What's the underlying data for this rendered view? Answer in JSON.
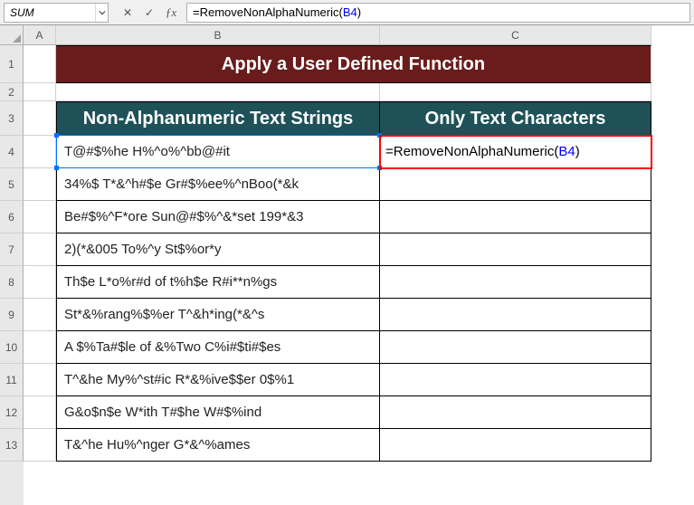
{
  "nameBox": "SUM",
  "formulaBar": {
    "prefix": "=RemoveNonAlphaNumeric(",
    "ref": "B4",
    "suffix": ")"
  },
  "columns": {
    "A": "A",
    "B": "B",
    "C": "C"
  },
  "rowNumbers": [
    "1",
    "2",
    "3",
    "4",
    "5",
    "6",
    "7",
    "8",
    "9",
    "10",
    "11",
    "12",
    "13"
  ],
  "title": "Apply a User Defined Function",
  "headers": {
    "B": "Non-Alphanumeric Text Strings",
    "C": "Only Text Characters"
  },
  "rows": [
    "T@#$%he H%^o%^bb@#it",
    "34%$ T*&^h#$e Gr#$%ee%^nBoo(*&k",
    "Be#$%^F*ore Sun@#$%^&*set 199*&3",
    "2)(*&005 To%^y St$%or*y",
    "Th$e L*o%r#d of t%h$e R#i**n%gs",
    "St*&%rang%$%er T^&h*ing(*&^s",
    "A $%Ta#$le of &%Two C%i#$ti#$es",
    "T^&he My%^st#ic R*&%ive$$er 0$%1",
    "G&o$n$e W*ith T#$he W#$%ind",
    "T&^he Hu%^nger G*&^%ames"
  ],
  "activeFormula": {
    "prefix": "=RemoveNonAlphaNumeric(",
    "ref": "B4",
    "suffix": ")"
  },
  "icons": {
    "cancel": "✕",
    "confirm": "✓"
  },
  "rowHeights": {
    "h1": 42,
    "h2": 20,
    "h3": 38,
    "data": 36
  }
}
